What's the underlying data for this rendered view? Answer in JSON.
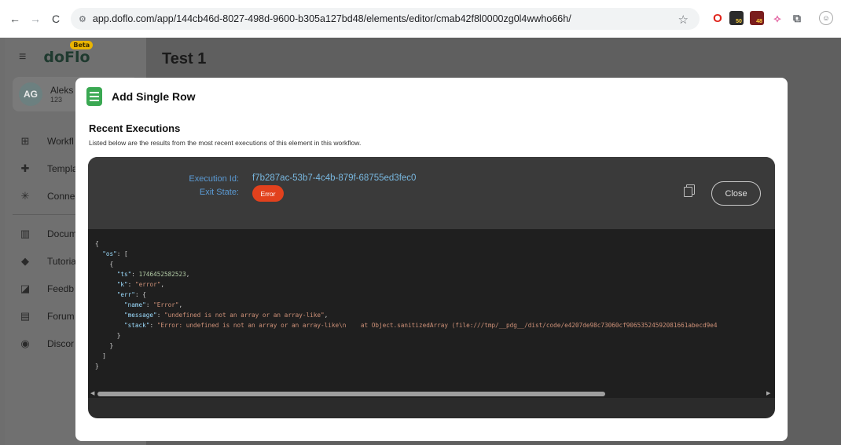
{
  "browser": {
    "url": "app.doflo.com/app/144cb46d-8027-498d-9600-b305a127bd48/elements/editor/cmab42f8l0000zg0l4wwho66h/",
    "ext_badges": [
      "50",
      "48"
    ]
  },
  "app": {
    "logo": "doFlo",
    "beta": "Beta",
    "page_title": "Test 1",
    "user": {
      "initials": "AG",
      "name": "Aleks",
      "sub": "123"
    },
    "menu": [
      {
        "label": "Workfl",
        "icon": "workflow-icon"
      },
      {
        "label": "Templa",
        "icon": "puzzle-icon"
      },
      {
        "label": "Conne",
        "icon": "connections-icon"
      },
      {
        "label": "Docum",
        "icon": "book-icon"
      },
      {
        "label": "Tutoria",
        "icon": "graduation-cap-icon"
      },
      {
        "label": "Feedb",
        "icon": "feedback-icon"
      },
      {
        "label": "Forum",
        "icon": "forum-icon"
      },
      {
        "label": "Discor",
        "icon": "discord-icon"
      }
    ]
  },
  "modal": {
    "title": "Add Single Row",
    "section_title": "Recent Executions",
    "section_desc": "Listed below are the results from the most recent executions of this element in this workflow.",
    "execution_id_label": "Execution Id:",
    "execution_id": "f7b287ac-53b7-4c4b-879f-68755ed3fec0",
    "exit_state_label": "Exit State:",
    "exit_state": "Error",
    "close_label": "Close",
    "json": {
      "k_os": "\"os\"",
      "k_ts": "\"ts\"",
      "ts": "1746452582523",
      "k_k": "\"k\"",
      "kval": "\"error\"",
      "k_err": "\"err\"",
      "k_name": "\"name\"",
      "name": "\"Error\"",
      "k_message": "\"message\"",
      "message": "\"undefined is not an array or an array-like\"",
      "k_stack": "\"stack\"",
      "stack": "\"Error: undefined is not an array or an array-like\\n    at Object.sanitizedArray (file:///tmp/__pdg__/dist/code/e4207de98c73060cf90653524592081661abecd9e4"
    }
  }
}
